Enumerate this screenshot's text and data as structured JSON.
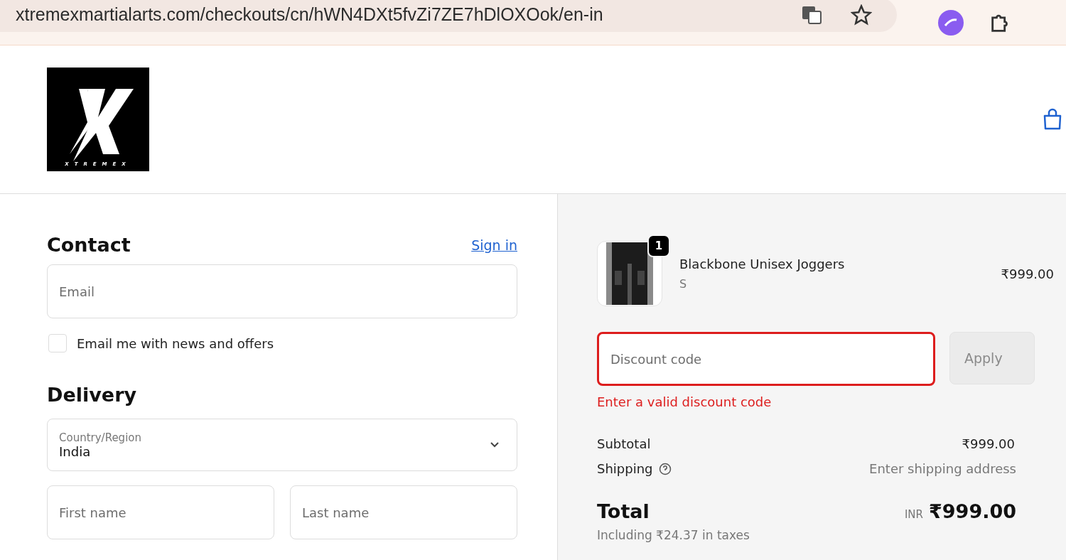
{
  "browser": {
    "url": "xtremexmartialarts.com/checkouts/cn/hWN4DXt5fvZi7ZE7hDlOXOok/en-in"
  },
  "header": {
    "logo_text": "XTREMEX"
  },
  "contact": {
    "title": "Contact",
    "sign_in": "Sign in",
    "email": {
      "placeholder": "Email"
    },
    "newsletter": {
      "label": "Email me with news and offers",
      "checked": false
    }
  },
  "delivery": {
    "title": "Delivery",
    "country": {
      "label": "Country/Region",
      "value": "India"
    },
    "first_name": {
      "placeholder": "First name"
    },
    "last_name": {
      "placeholder": "Last name"
    }
  },
  "summary": {
    "item": {
      "quantity": "1",
      "name": "Blackbone Unisex Joggers",
      "variant": "S",
      "price": "₹999.00"
    },
    "discount": {
      "placeholder": "Discount code",
      "button": "Apply",
      "error": "Enter a valid discount code",
      "invalid": true
    },
    "subtotal": {
      "label": "Subtotal",
      "value": "₹999.00"
    },
    "shipping": {
      "label": "Shipping",
      "value": "Enter shipping address"
    },
    "total": {
      "label": "Total",
      "currency": "INR",
      "value": "₹999.00",
      "taxes": "Including ₹24.37 in taxes"
    }
  }
}
